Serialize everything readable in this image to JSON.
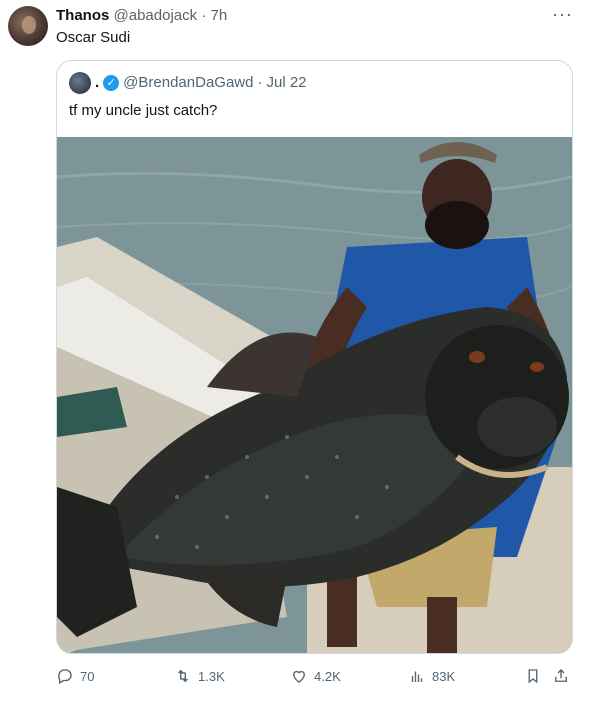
{
  "tweet": {
    "author_name": "Thanos",
    "handle": "@abadojack",
    "separator": "·",
    "time": "7h",
    "text": "Oscar Sudi",
    "more_icon": "more-dots-icon"
  },
  "quote": {
    "author_name": ".",
    "handle": "@BrendanDaGawd",
    "separator": "·",
    "date": "Jul 22",
    "text": "tf my uncle just catch?",
    "verified_icon": "verified-badge-icon"
  },
  "actions": {
    "replies": "70",
    "retweets": "1.3K",
    "likes": "4.2K",
    "views": "83K"
  },
  "colors": {
    "muted": "#536471",
    "verified": "#1d9bf0",
    "border": "#cfd9de"
  }
}
